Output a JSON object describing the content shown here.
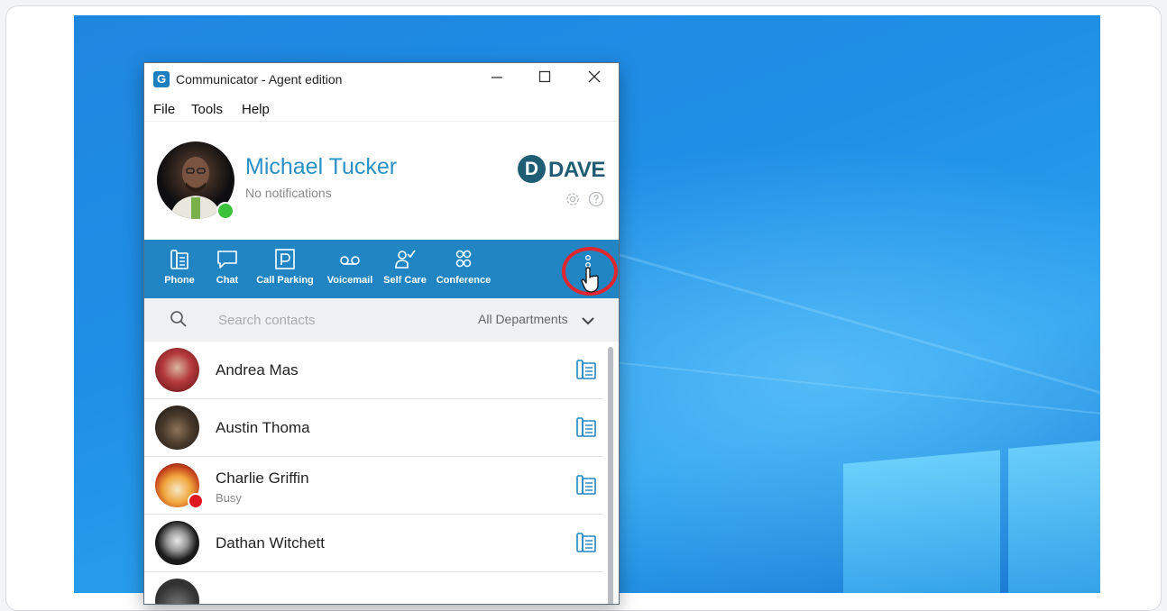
{
  "window": {
    "app_logo_letter": "G",
    "title": "Communicator - Agent edition",
    "controls": {
      "minimize": "—",
      "maximize": "☐",
      "close": "✕"
    }
  },
  "menu": [
    "File",
    "Tools",
    "Help"
  ],
  "profile": {
    "name": "Michael Tucker",
    "status": "No notifications",
    "presence_color": "#3cc33c",
    "brand_letter": "D",
    "brand_text": "DAVE"
  },
  "toolbar": {
    "items": [
      {
        "label": "Phone",
        "icon": "phone-icon"
      },
      {
        "label": "Chat",
        "icon": "chat-icon"
      },
      {
        "label": "Call Parking",
        "icon": "parking-icon"
      },
      {
        "label": "Voicemail",
        "icon": "voicemail-icon"
      },
      {
        "label": "Self Care",
        "icon": "self-care-icon"
      },
      {
        "label": "Conference",
        "icon": "conference-icon"
      }
    ],
    "more_icon": "more-vertical-icon",
    "highlight_color": "#e0272e",
    "accent": "#2185c3"
  },
  "search": {
    "placeholder": "Search contacts",
    "department": "All Departments"
  },
  "contacts": [
    {
      "name": "Andrea Mas",
      "sub": ""
    },
    {
      "name": "Austin Thoma",
      "sub": ""
    },
    {
      "name": "Charlie Griffin",
      "sub": "Busy",
      "presence_color": "#e01822"
    },
    {
      "name": "Dathan Witchett",
      "sub": ""
    }
  ]
}
